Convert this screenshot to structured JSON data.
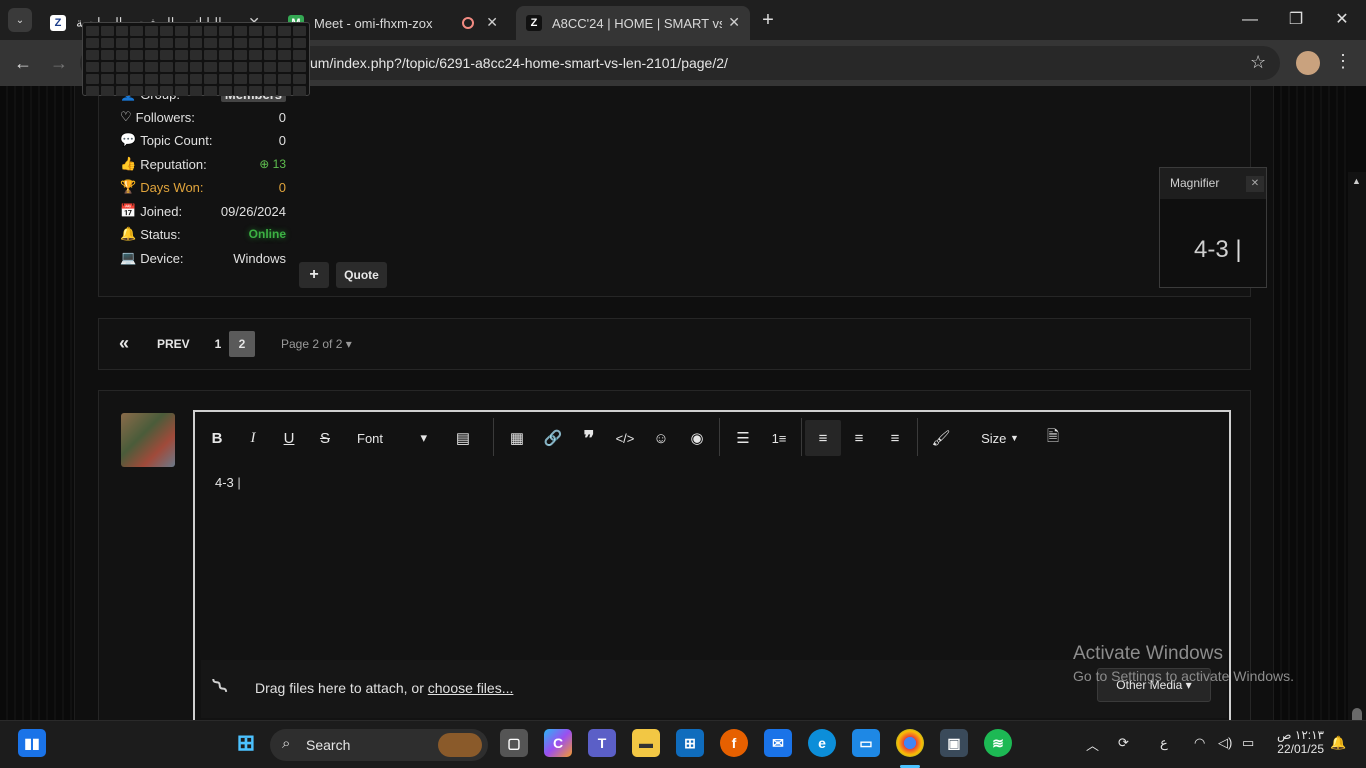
{
  "browser": {
    "tabs": [
      {
        "title": "الدوري الياباني والمشجع والمواجهة",
        "favicon": "Z"
      },
      {
        "title": "Meet - omi-fhxm-zox",
        "favicon": "M"
      },
      {
        "title": "A8CC'24 | HOME | SMART vs LEN",
        "favicon": "Z"
      }
    ],
    "url": "um/index.php?/topic/6291-a8cc24-home-smart-vs-len-2101/page/2/"
  },
  "profile": {
    "group_label": "Group:",
    "group_value": "Members",
    "rows": [
      {
        "label": "Followers:",
        "value": "0",
        "icon": "heart-icon"
      },
      {
        "label": "Topic Count:",
        "value": "0",
        "icon": "comments-icon"
      },
      {
        "label": "Reputation:",
        "value": "13",
        "icon": "thumbs-up-icon"
      },
      {
        "label": "Days Won:",
        "value": "0",
        "icon": "trophy-icon"
      },
      {
        "label": "Joined:",
        "value": "09/26/2024",
        "icon": "calendar-icon"
      },
      {
        "label": "Status:",
        "value": "Online",
        "icon": "bell-icon"
      },
      {
        "label": "Device:",
        "value": "Windows",
        "icon": "laptop-icon"
      }
    ],
    "quote_label": "Quote",
    "plus_label": "+"
  },
  "pagination": {
    "prev_label": "PREV",
    "pages": [
      "1",
      "2"
    ],
    "current": "2",
    "page_of": "Page 2 of 2"
  },
  "editor": {
    "font_label": "Font",
    "size_label": "Size",
    "content": "4-3",
    "attach_text": "Drag files here to attach, or ",
    "attach_link": "choose files...",
    "other_media": "Other Media"
  },
  "magnifier": {
    "title": "Magnifier",
    "content": "4-3"
  },
  "watermark": {
    "line1": "Activate Windows",
    "line2": "Go to Settings to activate Windows."
  },
  "taskbar": {
    "search_label": "Search",
    "time": "١٢:١٣ ص",
    "date": "22/01/25",
    "lang": "ع"
  },
  "colors": {
    "gold": "#e0a43c",
    "online": "#3cb043",
    "rep_green": "#5fbf4f"
  }
}
